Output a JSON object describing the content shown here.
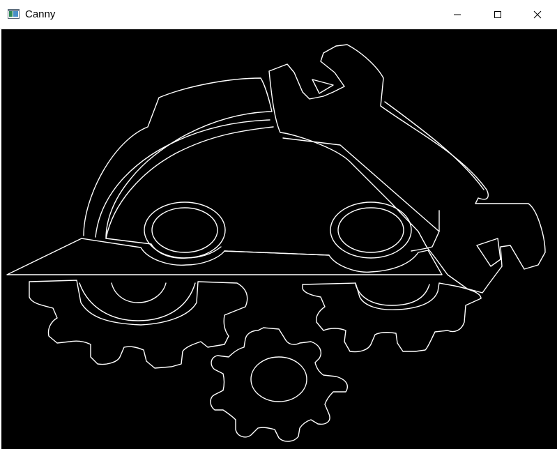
{
  "window": {
    "title": "Canny",
    "app_icon": "opencv-window-icon",
    "controls": {
      "minimize_icon": "minimize-icon",
      "maximize_icon": "maximize-icon",
      "close_icon": "close-icon"
    }
  },
  "canvas": {
    "description_icon": "canny-edge-image",
    "background_color": "#000000",
    "edge_color": "#ffffff"
  }
}
